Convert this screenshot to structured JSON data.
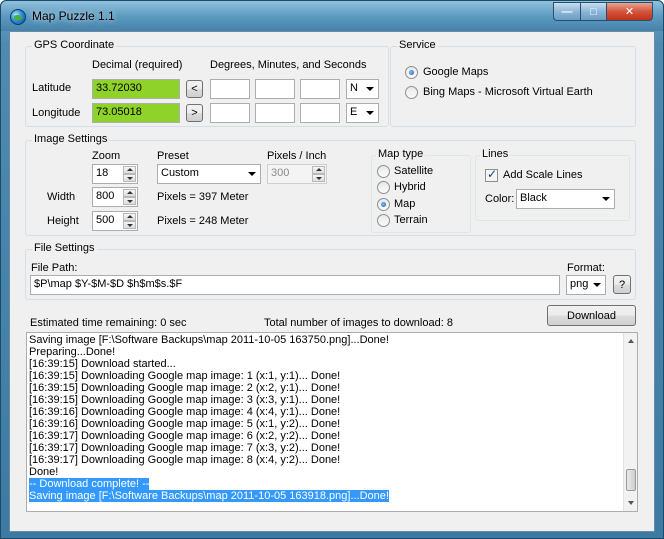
{
  "window": {
    "title": "Map Puzzle 1.1",
    "minimize_glyph": "—",
    "maximize_glyph": "□",
    "close_glyph": "✕"
  },
  "gps": {
    "group_label": "GPS Coordinate",
    "decimal_header": "Decimal (required)",
    "dms_header": "Degrees, Minutes, and Seconds",
    "latitude_label": "Latitude",
    "latitude_value": "33.72030",
    "latitude_arrow": "<",
    "latitude_deg": "",
    "latitude_min": "",
    "latitude_sec": "",
    "latitude_dir": "N",
    "longitude_label": "Longitude",
    "longitude_value": "73.05018",
    "longitude_arrow": ">",
    "longitude_deg": "",
    "longitude_min": "",
    "longitude_sec": "",
    "longitude_dir": "E",
    "valid_color": "#8ed22a"
  },
  "service": {
    "group_label": "Service",
    "options": [
      {
        "label": "Google Maps",
        "checked": true
      },
      {
        "label": "Bing Maps - Microsoft Virtual Earth",
        "checked": false
      }
    ]
  },
  "image_settings": {
    "group_label": "Image Settings",
    "zoom_label": "Zoom",
    "zoom_value": "18",
    "preset_label": "Preset",
    "preset_value": "Custom",
    "ppi_label": "Pixels / Inch",
    "ppi_value": "300",
    "width_label": "Width",
    "width_value": "800",
    "width_info": "Pixels = 397 Meter",
    "height_label": "Height",
    "height_value": "500",
    "height_info": "Pixels = 248 Meter",
    "map_type": {
      "label": "Map type",
      "options": [
        {
          "label": "Satellite",
          "checked": false
        },
        {
          "label": "Hybrid",
          "checked": false
        },
        {
          "label": "Map",
          "checked": true
        },
        {
          "label": "Terrain",
          "checked": false
        }
      ]
    },
    "lines": {
      "label": "Lines",
      "add_scale_label": "Add Scale Lines",
      "add_scale_checked": true,
      "color_label": "Color:",
      "color_value": "Black"
    }
  },
  "file_settings": {
    "group_label": "File Settings",
    "path_label": "File Path:",
    "path_value": "$P\\map $Y-$M-$D $h$m$s.$F",
    "format_label": "Format:",
    "format_value": "png",
    "help_button": "?"
  },
  "status": {
    "time_remaining": "Estimated time remaining: 0 sec",
    "total_images": "Total number of images to download: 8",
    "download_button": "Download"
  },
  "log": {
    "lines": [
      {
        "text": "Saving image [F:\\Software Backups\\map 2011-10-05 163750.png]...Done!",
        "selected": false
      },
      {
        "text": "Preparing...Done!",
        "selected": false
      },
      {
        "text": "[16:39:15] Download started...",
        "selected": false
      },
      {
        "text": "[16:39:15] Downloading Google map image: 1 (x:1, y:1)... Done!",
        "selected": false
      },
      {
        "text": "[16:39:15] Downloading Google map image: 2 (x:2, y:1)... Done!",
        "selected": false
      },
      {
        "text": "[16:39:15] Downloading Google map image: 3 (x:3, y:1)... Done!",
        "selected": false
      },
      {
        "text": "[16:39:16] Downloading Google map image: 4 (x:4, y:1)... Done!",
        "selected": false
      },
      {
        "text": "[16:39:16] Downloading Google map image: 5 (x:1, y:2)... Done!",
        "selected": false
      },
      {
        "text": "[16:39:17] Downloading Google map image: 6 (x:2, y:2)... Done!",
        "selected": false
      },
      {
        "text": "[16:39:17] Downloading Google map image: 7 (x:3, y:2)... Done!",
        "selected": false
      },
      {
        "text": "[16:39:17] Downloading Google map image: 8 (x:4, y:2)... Done!",
        "selected": false
      },
      {
        "text": "Done!",
        "selected": false
      },
      {
        "text": "-- Download complete! --",
        "selected": true
      },
      {
        "text": "Saving image [F:\\Software Backups\\map 2011-10-05 163918.png]...Done!",
        "selected": true
      }
    ],
    "selection_color": "#3399ff"
  }
}
